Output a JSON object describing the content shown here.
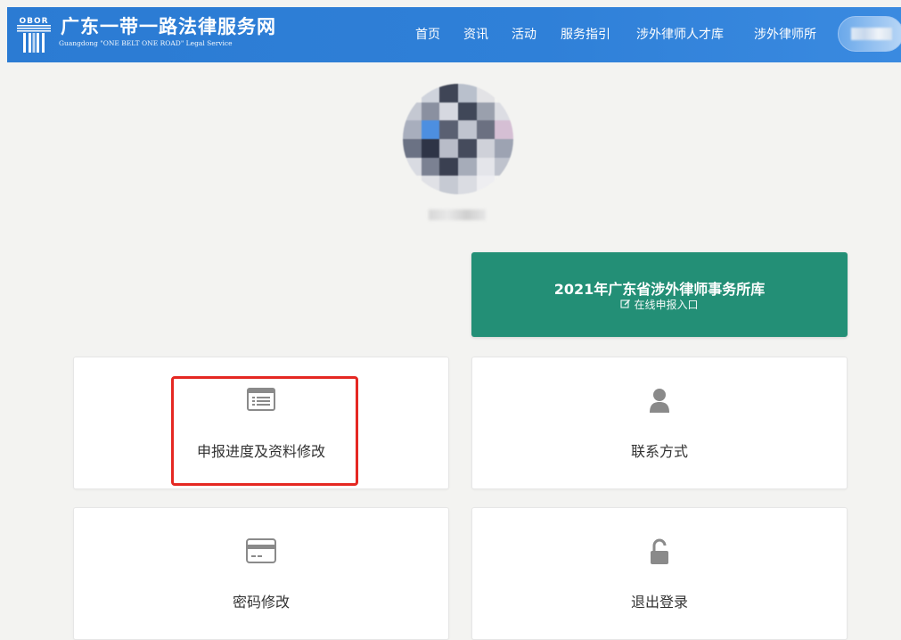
{
  "header": {
    "logo_letters": "OBOR",
    "title": "广东一带一路法律服务网",
    "subtitle": "Guangdong \"ONE BELT ONE ROAD\" Legal Service",
    "nav": [
      "首页",
      "资讯",
      "活动",
      "服务指引",
      "涉外律师人才库",
      "涉外律师所"
    ]
  },
  "banner": {
    "title": "2021年广东省涉外律师事务所库",
    "subtitle": "在线申报入口",
    "color": "#238f76"
  },
  "cards": [
    {
      "label": "申报进度及资料修改",
      "icon": "list-card-icon"
    },
    {
      "label": "联系方式",
      "icon": "user-icon"
    },
    {
      "label": "密码修改",
      "icon": "credit-card-icon"
    },
    {
      "label": "退出登录",
      "icon": "unlock-icon"
    }
  ],
  "colors": {
    "header": "#2f80d8",
    "highlight": "#e52822",
    "icon": "#888888",
    "background": "#f3f3f1"
  }
}
